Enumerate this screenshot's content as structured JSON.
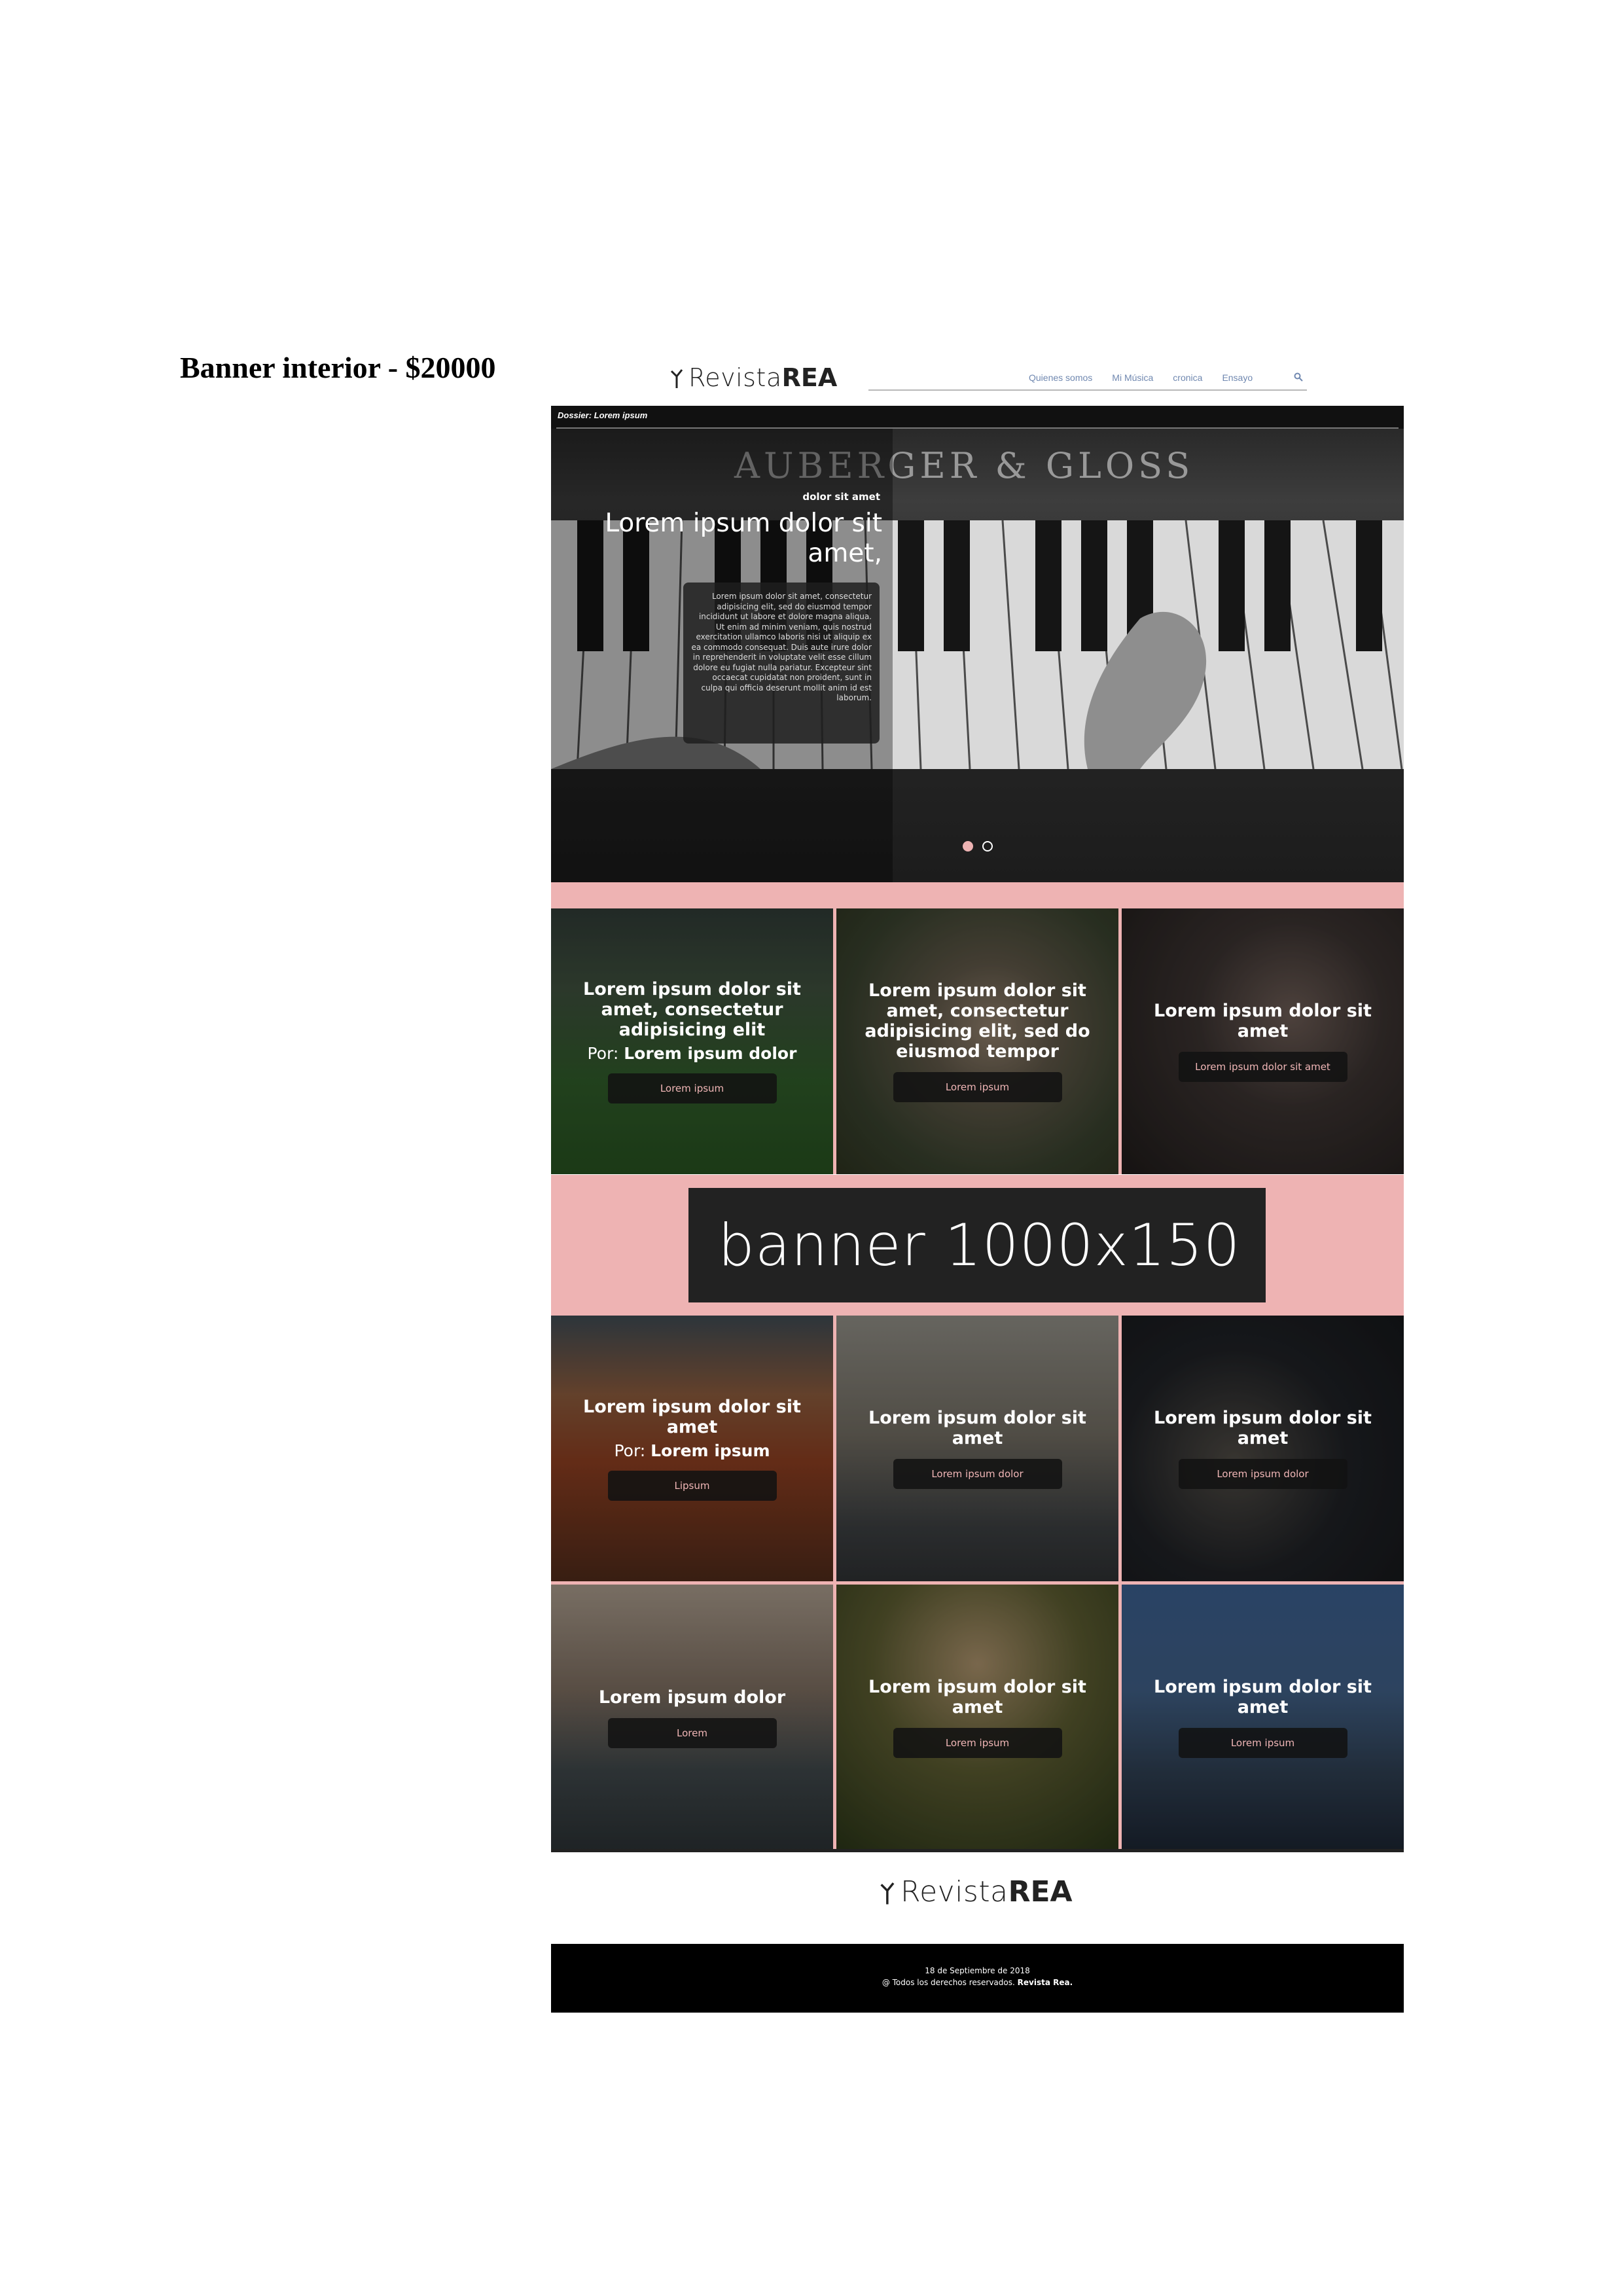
{
  "doc": {
    "heading": "Banner interior - $20000"
  },
  "header": {
    "logo_light": "Revista",
    "logo_bold": "REA",
    "nav": [
      "Quienes somos",
      "Mi Música",
      "cronica",
      "Ensayo"
    ],
    "search_icon": "search-icon"
  },
  "hero": {
    "section_label": "Dossier: Lorem ipsum",
    "piano_brand": "AUBERGER & GLOSS",
    "kicker": "dolor sit amet",
    "title": "Lorem ipsum dolor sit amet,",
    "body": "Lorem ipsum dolor sit amet, consectetur adipisicing elit, sed do eiusmod tempor incididunt ut labore et dolore magna aliqua. Ut enim ad minim veniam, quis nostrud exercitation ullamco laboris nisi ut aliquip ex ea commodo consequat. Duis aute irure dolor in reprehenderit in voluptate velit esse cillum dolore eu fugiat nulla pariatur. Excepteur sint occaecat cupidatat non proident, sunt in culpa qui officia deserunt mollit anim id est laborum.",
    "slides_total": 2,
    "slide_active": 1
  },
  "cards_row1": [
    {
      "title": "Lorem ipsum dolor sit amet, consectetur adipisicing elit",
      "author_prefix": "Por:",
      "author": "Lorem ipsum dolor",
      "button": "Lorem ipsum"
    },
    {
      "title": "Lorem ipsum dolor sit amet, consectetur adipisicing elit, sed do eiusmod tempor",
      "button": "Lorem ipsum"
    },
    {
      "title": "Lorem ipsum dolor sit amet",
      "button": "Lorem ipsum dolor sit amet"
    }
  ],
  "banner": {
    "label": "banner 1000x150"
  },
  "cards_row2": [
    {
      "title": "Lorem ipsum dolor sit amet",
      "author_prefix": "Por:",
      "author": "Lorem ipsum",
      "button": "Lipsum"
    },
    {
      "title": "Lorem ipsum dolor sit amet",
      "button": "Lorem ipsum dolor"
    },
    {
      "title": "Lorem ipsum dolor sit amet",
      "button": "Lorem ipsum dolor"
    }
  ],
  "cards_row3": [
    {
      "title": "Lorem ipsum dolor",
      "button": "Lorem"
    },
    {
      "title": "Lorem ipsum dolor sit amet",
      "button": "Lorem ipsum"
    },
    {
      "title": "Lorem ipsum dolor sit amet",
      "button": "Lorem ipsum"
    }
  ],
  "footer": {
    "date": "18 de Septiembre de 2018",
    "rights_prefix": "@ Todos los derechos reservados.",
    "rights_brand": "Revista Rea."
  },
  "colors": {
    "accent_pink": "#eeb3b3",
    "nav_blue": "#7088b0",
    "footer_bg": "#000000"
  }
}
